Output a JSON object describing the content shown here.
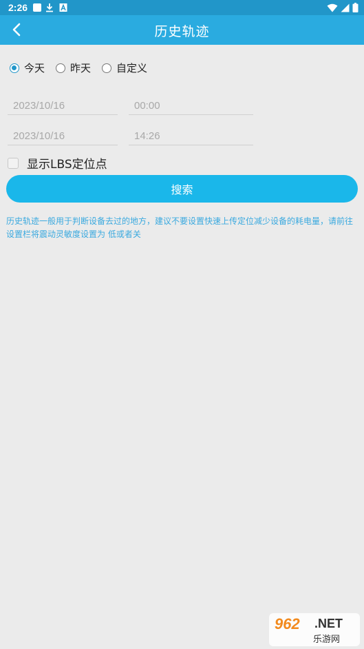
{
  "status_bar": {
    "time": "2:26",
    "icons": [
      "notification-square-icon",
      "download-icon",
      "app-a-icon",
      "wifi-icon",
      "signal-icon",
      "battery-icon"
    ]
  },
  "header": {
    "title": "历史轨迹",
    "back_icon": "chevron-left-icon"
  },
  "date_range": {
    "options": [
      {
        "label": "今天",
        "checked": true
      },
      {
        "label": "昨天",
        "checked": false
      },
      {
        "label": "自定义",
        "checked": false
      }
    ],
    "start_date": "2023/10/16",
    "start_time": "00:00",
    "end_date": "2023/10/16",
    "end_time": "14:26"
  },
  "lbs_checkbox": {
    "label": "显示LBS定位点",
    "checked": false
  },
  "search_button": {
    "label": "搜索"
  },
  "hint_text": "历史轨迹一般用于判断设备去过的地方，建议不要设置快速上传定位减少设备的耗电量，请前往设置栏将震动灵敏度设置为 低或者关",
  "watermark": {
    "logo": "962",
    "domain": ".NET",
    "text": "乐游网"
  },
  "colors": {
    "status_bar": "#2196c9",
    "title_bar": "#2aabe0",
    "button": "#1ab7ea",
    "hint": "#3aa9df",
    "background": "#ebebeb"
  }
}
